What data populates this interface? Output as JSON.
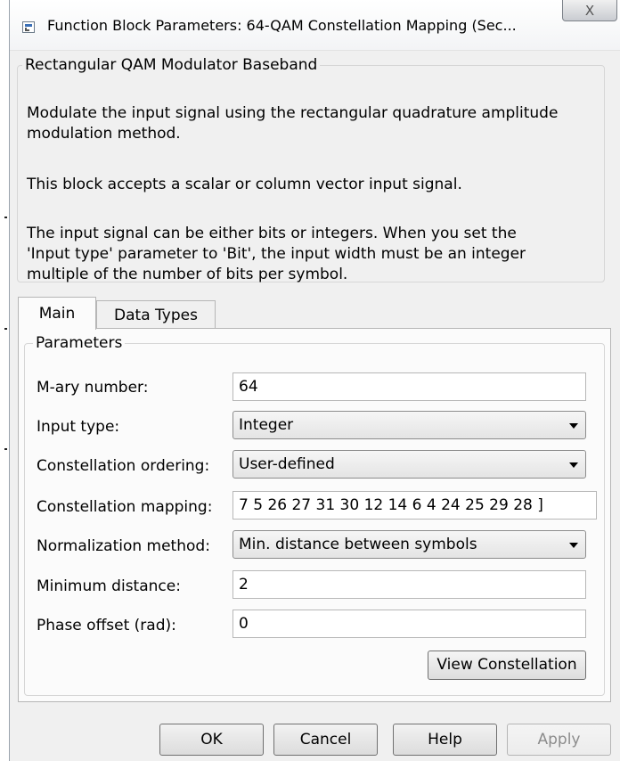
{
  "window": {
    "title": "Function Block Parameters: 64-QAM Constellation Mapping (Sec...",
    "close_glyph": "X"
  },
  "description": {
    "group_title": "Rectangular QAM Modulator Baseband",
    "lines": [
      "Modulate the input signal using the rectangular quadrature amplitude",
      "modulation method.",
      "This block accepts a scalar or column vector input signal.",
      "The input signal can be either bits or integers. When you set the",
      "'Input type' parameter to 'Bit', the input width must be an integer",
      "multiple of the number of bits per symbol."
    ]
  },
  "tabs": [
    {
      "label": "Main",
      "active": true
    },
    {
      "label": "Data Types",
      "active": false
    }
  ],
  "parameters": {
    "group_title": "Parameters",
    "m_ary": {
      "label": "M-ary number:",
      "value": "64"
    },
    "input_type": {
      "label": "Input type:",
      "value": "Integer"
    },
    "ordering": {
      "label": "Constellation ordering:",
      "value": "User-defined"
    },
    "mapping": {
      "label": "Constellation mapping:",
      "value": "7  5 26 27 31 30 12 14  6  4 24 25 29 28 ]"
    },
    "normalization": {
      "label": "Normalization method:",
      "value": "Min. distance between symbols"
    },
    "min_distance": {
      "label": "Minimum distance:",
      "value": "2"
    },
    "phase_offset": {
      "label": "Phase offset (rad):",
      "value": "0"
    },
    "view_button": "View Constellation"
  },
  "footer": {
    "ok": "OK",
    "cancel": "Cancel",
    "help": "Help",
    "apply": "Apply"
  }
}
